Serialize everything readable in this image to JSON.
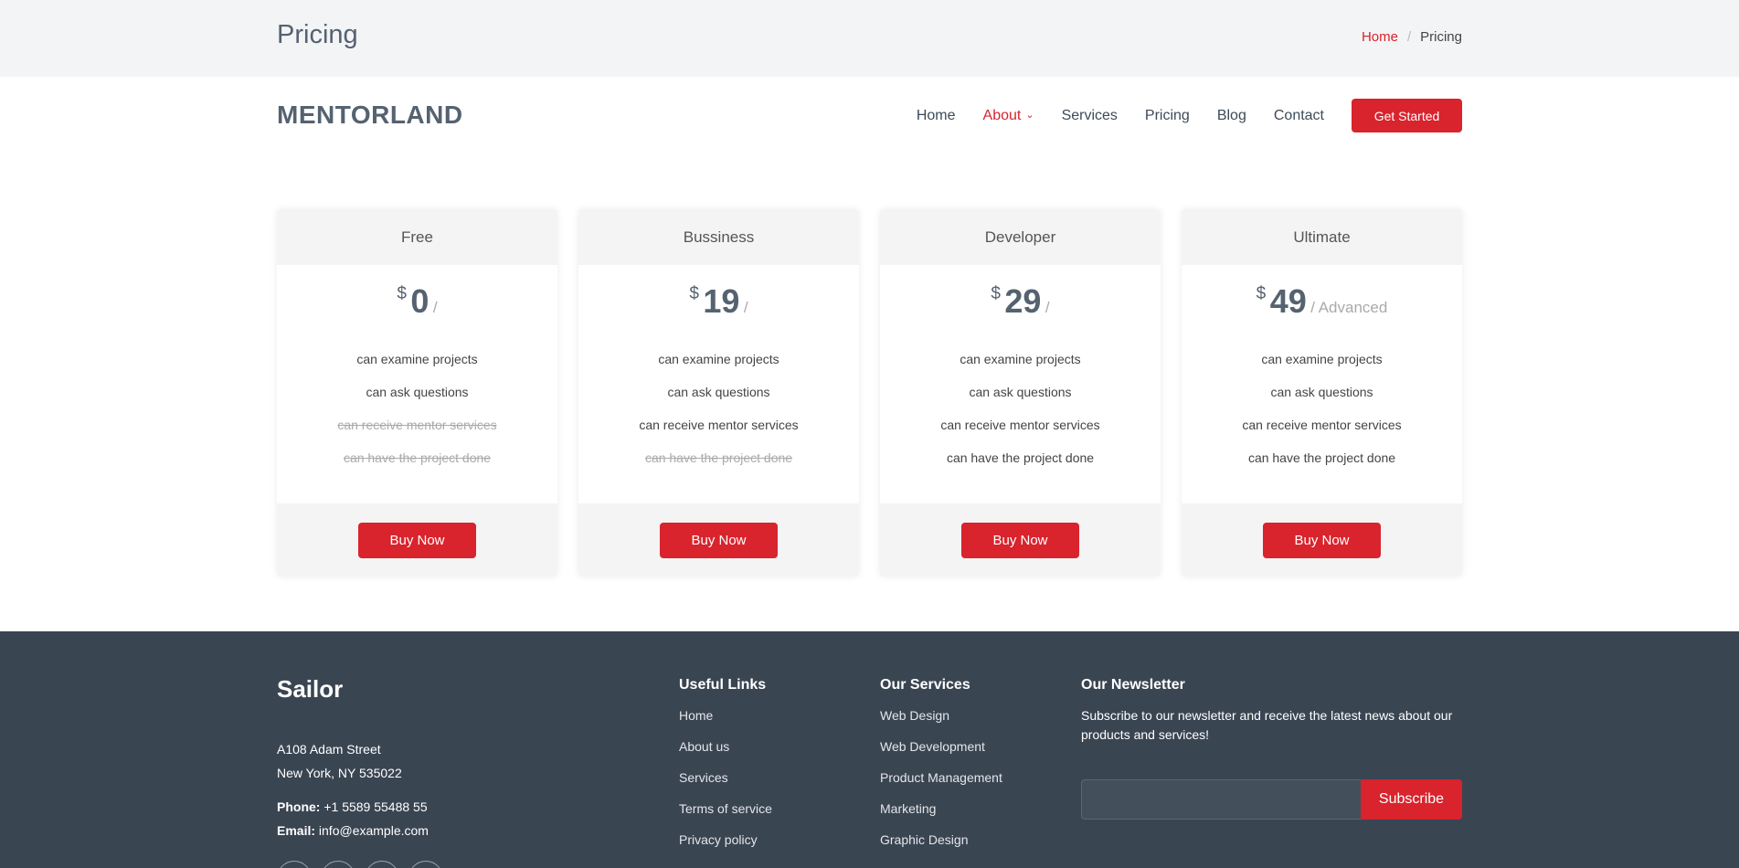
{
  "breadcrumb_bar": {
    "title": "Pricing",
    "home": "Home",
    "separator": "/",
    "current": "Pricing"
  },
  "header": {
    "logo": "MENTORLAND",
    "nav": [
      "Home",
      "About",
      "Services",
      "Pricing",
      "Blog",
      "Contact"
    ],
    "active_nav": "About",
    "cta": "Get Started"
  },
  "plans": [
    {
      "name": "Free",
      "currency": "$",
      "amount": "0",
      "period": "/",
      "features": [
        {
          "text": "can examine projects",
          "available": true
        },
        {
          "text": "can ask questions",
          "available": true
        },
        {
          "text": "can receive mentor services",
          "available": false
        },
        {
          "text": "can have the project done",
          "available": false
        }
      ],
      "button": "Buy Now"
    },
    {
      "name": "Bussiness",
      "currency": "$",
      "amount": "19",
      "period": "/",
      "features": [
        {
          "text": "can examine projects",
          "available": true
        },
        {
          "text": "can ask questions",
          "available": true
        },
        {
          "text": "can receive mentor services",
          "available": true
        },
        {
          "text": "can have the project done",
          "available": false
        }
      ],
      "button": "Buy Now"
    },
    {
      "name": "Developer",
      "currency": "$",
      "amount": "29",
      "period": "/",
      "features": [
        {
          "text": "can examine projects",
          "available": true
        },
        {
          "text": "can ask questions",
          "available": true
        },
        {
          "text": "can receive mentor services",
          "available": true
        },
        {
          "text": "can have the project done",
          "available": true
        }
      ],
      "button": "Buy Now"
    },
    {
      "name": "Ultimate",
      "currency": "$",
      "amount": "49",
      "period": "/ Advanced",
      "features": [
        {
          "text": "can examine projects",
          "available": true
        },
        {
          "text": "can ask questions",
          "available": true
        },
        {
          "text": "can receive mentor services",
          "available": true
        },
        {
          "text": "can have the project done",
          "available": true
        }
      ],
      "button": "Buy Now"
    }
  ],
  "footer": {
    "brand": "Sailor",
    "address_line1": "A108 Adam Street",
    "address_line2": "New York, NY 535022",
    "phone_label": "Phone:",
    "phone": "+1 5589 55488 55",
    "email_label": "Email:",
    "email": "info@example.com",
    "useful_links": {
      "title": "Useful Links",
      "items": [
        "Home",
        "About us",
        "Services",
        "Terms of service",
        "Privacy policy"
      ]
    },
    "services": {
      "title": "Our Services",
      "items": [
        "Web Design",
        "Web Development",
        "Product Management",
        "Marketing",
        "Graphic Design"
      ]
    },
    "newsletter": {
      "title": "Our Newsletter",
      "text": "Subscribe to our newsletter and receive the latest news about our products and services!",
      "input_value": "",
      "button": "Subscribe"
    },
    "socials": [
      "twitter-icon",
      "facebook-icon",
      "instagram-icon",
      "linkedin-icon"
    ]
  },
  "colors": {
    "accent": "#d9232d",
    "footer_bg": "#3a4552",
    "heading": "#556270"
  }
}
